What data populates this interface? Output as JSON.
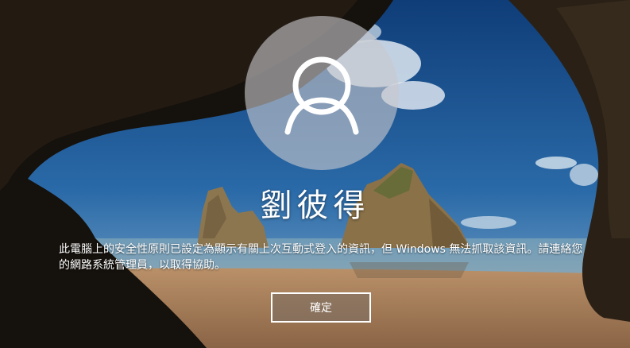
{
  "user": {
    "display_name": "劉彼得"
  },
  "notice": {
    "message": "此電腦上的安全性原則已設定為顯示有關上次互動式登入的資訊，但 Windows 無法抓取該資訊。請連絡您的網路系統管理員，以取得協助。"
  },
  "actions": {
    "ok_label": "確定"
  },
  "icons": {
    "avatar": "user-silhouette-icon"
  },
  "colors": {
    "sky": "#1e5a93",
    "sand": "#c79a6c",
    "rock": "#1c160f"
  }
}
